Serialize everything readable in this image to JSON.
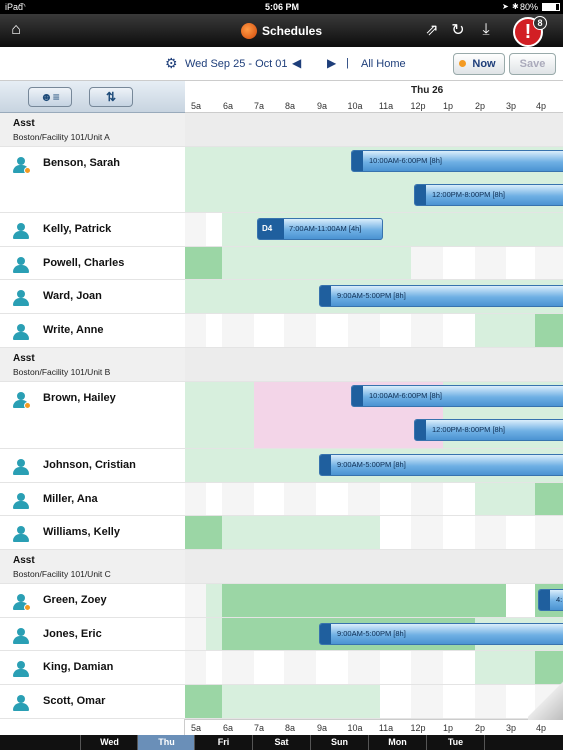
{
  "status": {
    "carrier": "iPad",
    "time": "5:06 PM",
    "battery": "80%"
  },
  "nav": {
    "title": "Schedules",
    "alert_count": "8",
    "alert_glyph": "!"
  },
  "toolbar": {
    "date_range": "Wed Sep 25 - Oct 01",
    "divider": "|",
    "view": "All Home",
    "now_label": "Now",
    "save_label": "Save"
  },
  "header": {
    "day_label": "Thu 26",
    "hours": [
      "5a",
      "6a",
      "7a",
      "8a",
      "9a",
      "10a",
      "11a",
      "12p",
      "1p",
      "2p",
      "3p",
      "4p"
    ]
  },
  "colors": {
    "light_green": "#d7efdd",
    "dark_green": "#9bd6a5",
    "pink": "#f3d5e8",
    "shift_blue": "#4b93d2",
    "alert_red": "#d21f24"
  },
  "groups": [
    {
      "title": "Asst",
      "location": "Boston/Facility 101/Unit A",
      "people": [
        {
          "name": "Benson, Sarah",
          "status_dot": true,
          "shifts": [
            {
              "label": "10:00AM-6:00PM [8h]",
              "start": 10,
              "end": 18
            },
            {
              "label": "12:00PM-8:00PM [8h]",
              "start": 12,
              "end": 20
            }
          ]
        },
        {
          "name": "Kelly, Patrick",
          "status_dot": false,
          "shifts": [
            {
              "label": "7:00AM-11:00AM [4h]",
              "code": "D4",
              "start": 7,
              "end": 11
            }
          ]
        },
        {
          "name": "Powell, Charles",
          "status_dot": false,
          "shifts": []
        },
        {
          "name": "Ward, Joan",
          "status_dot": false,
          "shifts": [
            {
              "label": "9:00AM-5:00PM [8h]",
              "start": 9,
              "end": 17
            }
          ]
        },
        {
          "name": "Write, Anne",
          "status_dot": false,
          "shifts": []
        }
      ]
    },
    {
      "title": "Asst",
      "location": "Boston/Facility 101/Unit B",
      "people": [
        {
          "name": "Brown, Hailey",
          "status_dot": true,
          "shifts": [
            {
              "label": "10:00AM-6:00PM [8h]",
              "start": 10,
              "end": 18
            },
            {
              "label": "12:00PM-8:00PM [8h]",
              "start": 12,
              "end": 20
            }
          ]
        },
        {
          "name": "Johnson, Cristian",
          "status_dot": false,
          "shifts": [
            {
              "label": "9:00AM-5:00PM [8h]",
              "start": 9,
              "end": 17
            }
          ]
        },
        {
          "name": "Miller, Ana",
          "status_dot": false,
          "shifts": []
        },
        {
          "name": "Williams, Kelly",
          "status_dot": false,
          "shifts": []
        }
      ]
    },
    {
      "title": "Asst",
      "location": "Boston/Facility 101/Unit C",
      "people": [
        {
          "name": "Green, Zoey",
          "status_dot": true,
          "shifts": [
            {
              "label": "4:",
              "start": 16,
              "end": 20
            }
          ]
        },
        {
          "name": "Jones, Eric",
          "status_dot": false,
          "shifts": [
            {
              "label": "9:00AM-5:00PM [8h]",
              "start": 9,
              "end": 17
            }
          ]
        },
        {
          "name": "King, Damian",
          "status_dot": false,
          "shifts": []
        },
        {
          "name": "Scott, Omar",
          "status_dot": false,
          "shifts": []
        }
      ]
    }
  ],
  "days": [
    "Wed",
    "Thu",
    "Fri",
    "Sat",
    "Sun",
    "Mon",
    "Tue"
  ],
  "selected_day": "Thu"
}
